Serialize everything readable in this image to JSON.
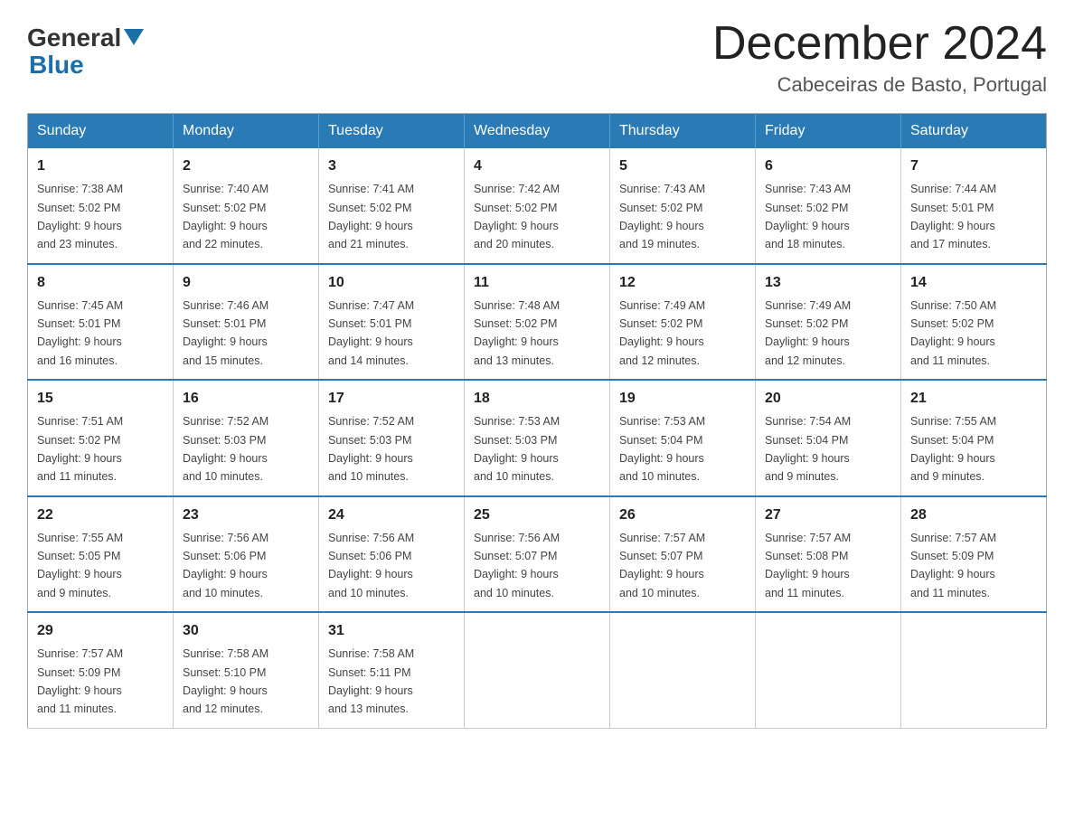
{
  "logo": {
    "text_general": "General",
    "text_blue": "Blue"
  },
  "header": {
    "title": "December 2024",
    "subtitle": "Cabeceiras de Basto, Portugal"
  },
  "weekdays": [
    "Sunday",
    "Monday",
    "Tuesday",
    "Wednesday",
    "Thursday",
    "Friday",
    "Saturday"
  ],
  "weeks": [
    [
      {
        "day": "1",
        "sunrise": "7:38 AM",
        "sunset": "5:02 PM",
        "daylight": "9 hours and 23 minutes."
      },
      {
        "day": "2",
        "sunrise": "7:40 AM",
        "sunset": "5:02 PM",
        "daylight": "9 hours and 22 minutes."
      },
      {
        "day": "3",
        "sunrise": "7:41 AM",
        "sunset": "5:02 PM",
        "daylight": "9 hours and 21 minutes."
      },
      {
        "day": "4",
        "sunrise": "7:42 AM",
        "sunset": "5:02 PM",
        "daylight": "9 hours and 20 minutes."
      },
      {
        "day": "5",
        "sunrise": "7:43 AM",
        "sunset": "5:02 PM",
        "daylight": "9 hours and 19 minutes."
      },
      {
        "day": "6",
        "sunrise": "7:43 AM",
        "sunset": "5:02 PM",
        "daylight": "9 hours and 18 minutes."
      },
      {
        "day": "7",
        "sunrise": "7:44 AM",
        "sunset": "5:01 PM",
        "daylight": "9 hours and 17 minutes."
      }
    ],
    [
      {
        "day": "8",
        "sunrise": "7:45 AM",
        "sunset": "5:01 PM",
        "daylight": "9 hours and 16 minutes."
      },
      {
        "day": "9",
        "sunrise": "7:46 AM",
        "sunset": "5:01 PM",
        "daylight": "9 hours and 15 minutes."
      },
      {
        "day": "10",
        "sunrise": "7:47 AM",
        "sunset": "5:01 PM",
        "daylight": "9 hours and 14 minutes."
      },
      {
        "day": "11",
        "sunrise": "7:48 AM",
        "sunset": "5:02 PM",
        "daylight": "9 hours and 13 minutes."
      },
      {
        "day": "12",
        "sunrise": "7:49 AM",
        "sunset": "5:02 PM",
        "daylight": "9 hours and 12 minutes."
      },
      {
        "day": "13",
        "sunrise": "7:49 AM",
        "sunset": "5:02 PM",
        "daylight": "9 hours and 12 minutes."
      },
      {
        "day": "14",
        "sunrise": "7:50 AM",
        "sunset": "5:02 PM",
        "daylight": "9 hours and 11 minutes."
      }
    ],
    [
      {
        "day": "15",
        "sunrise": "7:51 AM",
        "sunset": "5:02 PM",
        "daylight": "9 hours and 11 minutes."
      },
      {
        "day": "16",
        "sunrise": "7:52 AM",
        "sunset": "5:03 PM",
        "daylight": "9 hours and 10 minutes."
      },
      {
        "day": "17",
        "sunrise": "7:52 AM",
        "sunset": "5:03 PM",
        "daylight": "9 hours and 10 minutes."
      },
      {
        "day": "18",
        "sunrise": "7:53 AM",
        "sunset": "5:03 PM",
        "daylight": "9 hours and 10 minutes."
      },
      {
        "day": "19",
        "sunrise": "7:53 AM",
        "sunset": "5:04 PM",
        "daylight": "9 hours and 10 minutes."
      },
      {
        "day": "20",
        "sunrise": "7:54 AM",
        "sunset": "5:04 PM",
        "daylight": "9 hours and 9 minutes."
      },
      {
        "day": "21",
        "sunrise": "7:55 AM",
        "sunset": "5:04 PM",
        "daylight": "9 hours and 9 minutes."
      }
    ],
    [
      {
        "day": "22",
        "sunrise": "7:55 AM",
        "sunset": "5:05 PM",
        "daylight": "9 hours and 9 minutes."
      },
      {
        "day": "23",
        "sunrise": "7:56 AM",
        "sunset": "5:06 PM",
        "daylight": "9 hours and 10 minutes."
      },
      {
        "day": "24",
        "sunrise": "7:56 AM",
        "sunset": "5:06 PM",
        "daylight": "9 hours and 10 minutes."
      },
      {
        "day": "25",
        "sunrise": "7:56 AM",
        "sunset": "5:07 PM",
        "daylight": "9 hours and 10 minutes."
      },
      {
        "day": "26",
        "sunrise": "7:57 AM",
        "sunset": "5:07 PM",
        "daylight": "9 hours and 10 minutes."
      },
      {
        "day": "27",
        "sunrise": "7:57 AM",
        "sunset": "5:08 PM",
        "daylight": "9 hours and 11 minutes."
      },
      {
        "day": "28",
        "sunrise": "7:57 AM",
        "sunset": "5:09 PM",
        "daylight": "9 hours and 11 minutes."
      }
    ],
    [
      {
        "day": "29",
        "sunrise": "7:57 AM",
        "sunset": "5:09 PM",
        "daylight": "9 hours and 11 minutes."
      },
      {
        "day": "30",
        "sunrise": "7:58 AM",
        "sunset": "5:10 PM",
        "daylight": "9 hours and 12 minutes."
      },
      {
        "day": "31",
        "sunrise": "7:58 AM",
        "sunset": "5:11 PM",
        "daylight": "9 hours and 13 minutes."
      },
      null,
      null,
      null,
      null
    ]
  ],
  "labels": {
    "sunrise": "Sunrise:",
    "sunset": "Sunset:",
    "daylight": "Daylight:"
  }
}
